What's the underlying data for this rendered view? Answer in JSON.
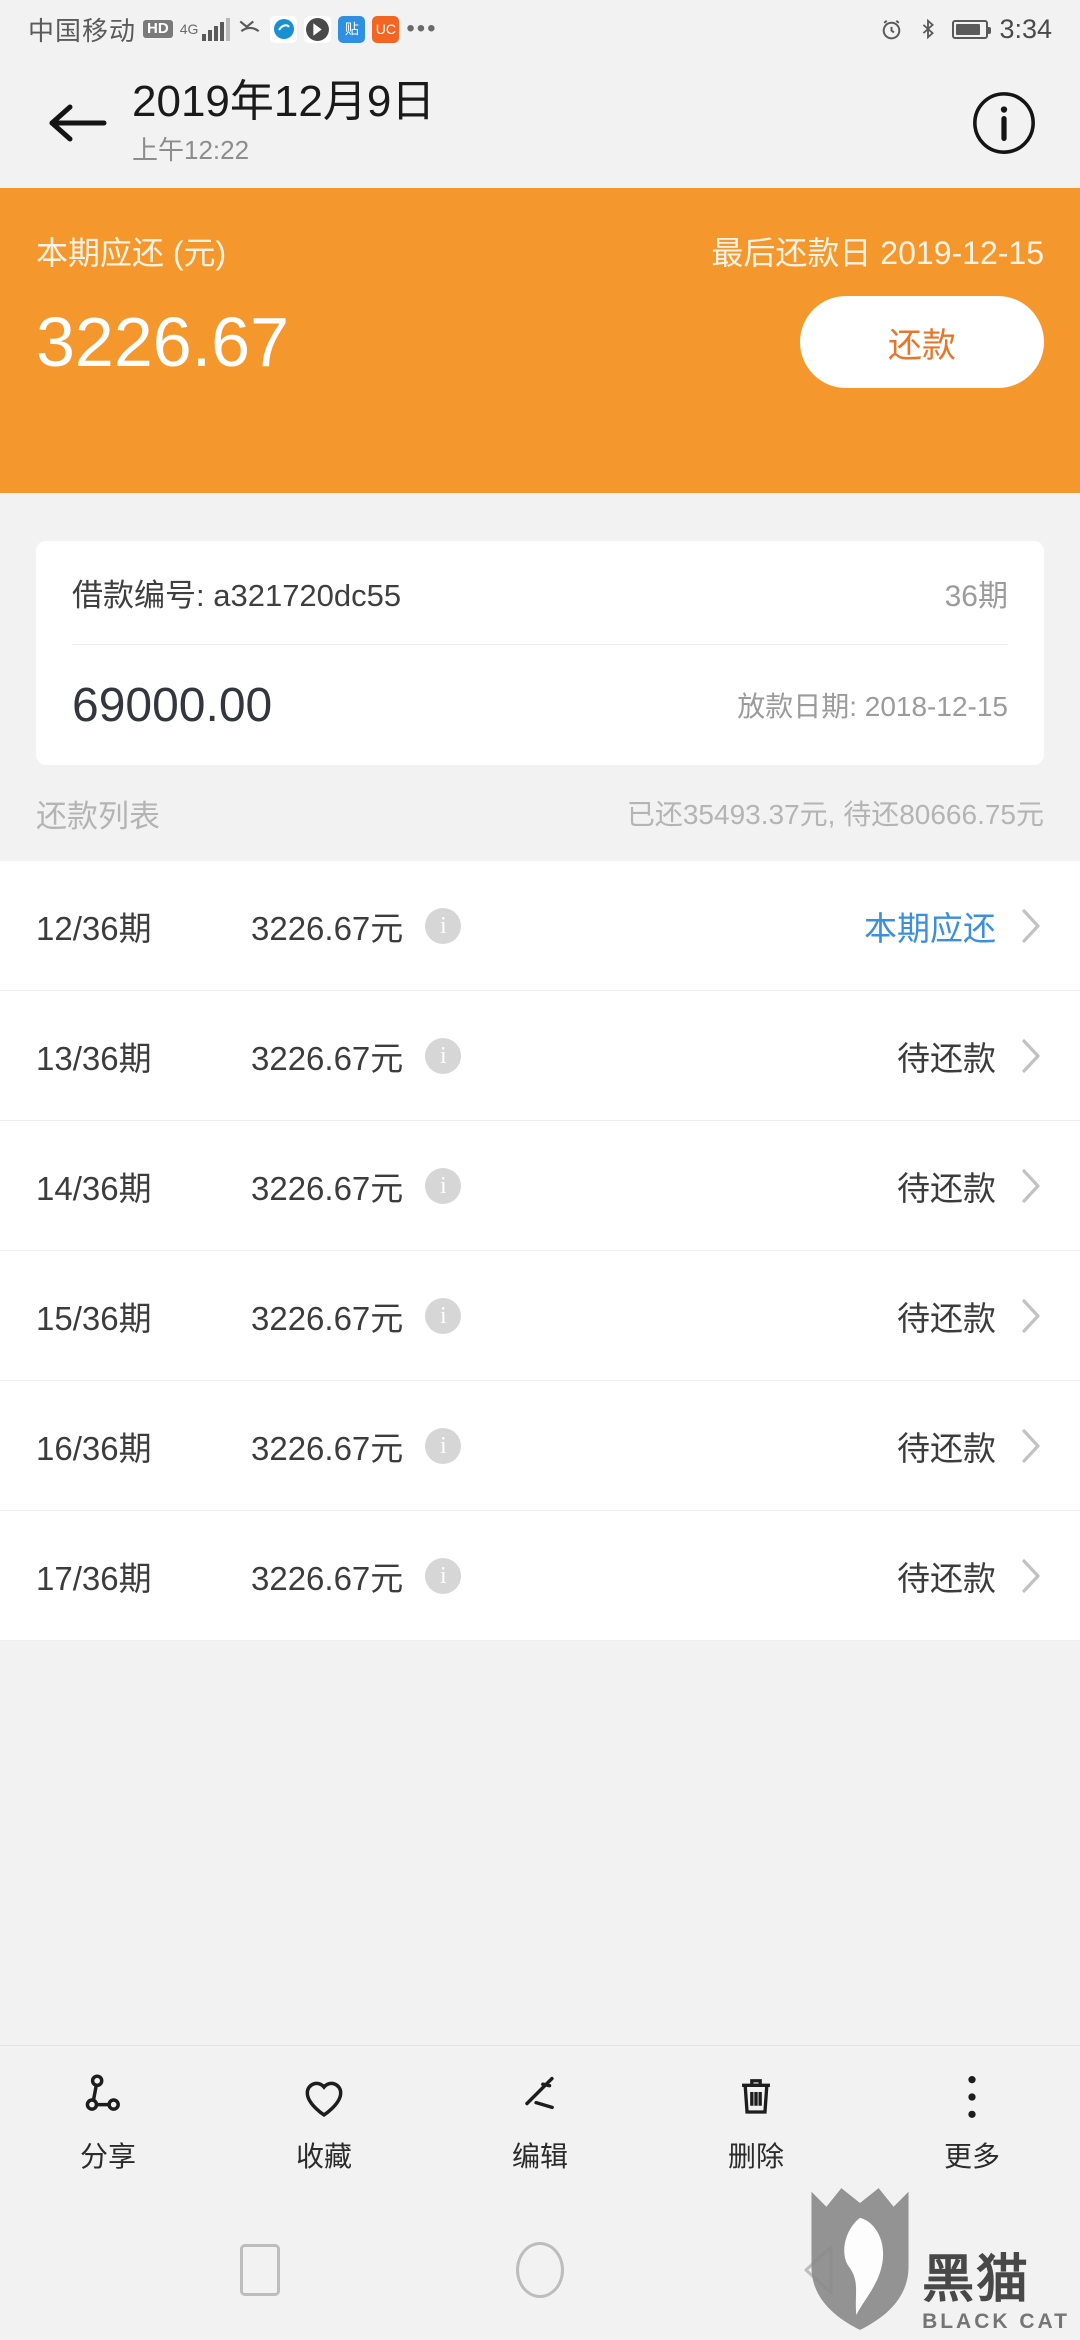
{
  "status_bar": {
    "carrier": "中国移动",
    "hd_badge": "HD",
    "network": "4G",
    "time": "3:34",
    "icons": [
      "hd-icon",
      "signal-bars-icon",
      "missed-call-icon",
      "app-icon-blue",
      "app-icon-dark",
      "app-icon-tieba",
      "app-icon-uc",
      "overflow-dots-icon",
      "alarm-icon",
      "bluetooth-icon",
      "battery-icon"
    ],
    "overflow": "•••"
  },
  "header": {
    "back_icon": "back-arrow-icon",
    "title": "2019年12月9日",
    "subtitle": "上午12:22",
    "info_icon": "info-circle-icon"
  },
  "banner": {
    "label": "本期应还 (元)",
    "due_date_text": "最后还款日 2019-12-15",
    "amount": "3226.67",
    "repay_button": "还款",
    "background_color": "#f4982e",
    "button_text_color": "#e8762a"
  },
  "loan_card": {
    "loan_no_label": "借款编号: a321720dc55",
    "terms": "36期",
    "principal": "69000.00",
    "disburse_date": "放款日期: 2018-12-15"
  },
  "list_header": {
    "title": "还款列表",
    "summary": "已还35493.37元, 待还80666.75元"
  },
  "repayment_rows": [
    {
      "term": "12/36期",
      "amount": "3226.67元",
      "info_icon": "i",
      "status": "本期应还",
      "is_current": true
    },
    {
      "term": "13/36期",
      "amount": "3226.67元",
      "info_icon": "i",
      "status": "待还款",
      "is_current": false
    },
    {
      "term": "14/36期",
      "amount": "3226.67元",
      "info_icon": "i",
      "status": "待还款",
      "is_current": false
    },
    {
      "term": "15/36期",
      "amount": "3226.67元",
      "info_icon": "i",
      "status": "待还款",
      "is_current": false
    },
    {
      "term": "16/36期",
      "amount": "3226.67元",
      "info_icon": "i",
      "status": "待还款",
      "is_current": false
    },
    {
      "term": "17/36期",
      "amount": "3226.67元",
      "info_icon": "i",
      "status": "待还款",
      "is_current": false
    }
  ],
  "toolbar": [
    {
      "label": "分享",
      "icon": "share-icon"
    },
    {
      "label": "收藏",
      "icon": "heart-icon"
    },
    {
      "label": "编辑",
      "icon": "pencil-icon"
    },
    {
      "label": "删除",
      "icon": "trash-icon"
    },
    {
      "label": "更多",
      "icon": "more-vertical-icon"
    }
  ],
  "nav_bar": {
    "recents_icon": "square-icon",
    "home_icon": "circle-icon",
    "back_icon": "triangle-back-icon"
  },
  "watermark": {
    "cn": "黑猫",
    "en": "BLACK CAT"
  },
  "colors": {
    "accent_orange": "#f4982e",
    "link_blue": "#3b8fdb",
    "page_bg": "#f2f2f2"
  }
}
